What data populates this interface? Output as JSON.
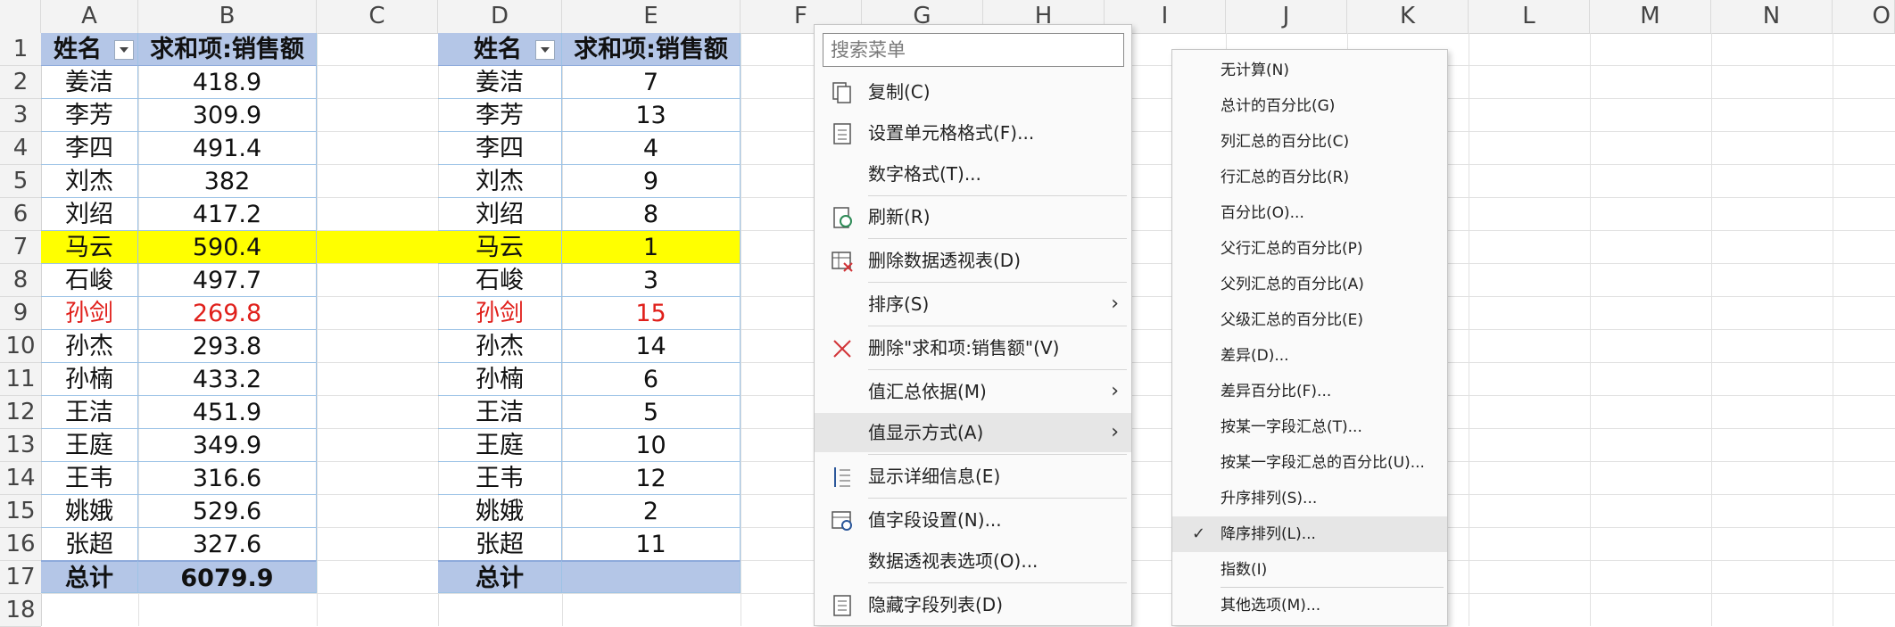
{
  "columns": [
    "A",
    "B",
    "C",
    "D",
    "E",
    "F",
    "G",
    "H",
    "I",
    "J",
    "K",
    "L",
    "M",
    "N",
    "O"
  ],
  "rows": [
    "1",
    "2",
    "3",
    "4",
    "5",
    "6",
    "7",
    "8",
    "9",
    "10",
    "11",
    "12",
    "13",
    "14",
    "15",
    "16",
    "17",
    "18"
  ],
  "pivot1": {
    "header_name": "姓名",
    "header_value": "求和项:销售额",
    "rows": [
      {
        "name": "姜洁",
        "value": "418.9"
      },
      {
        "name": "李芳",
        "value": "309.9"
      },
      {
        "name": "李四",
        "value": "491.4"
      },
      {
        "name": "刘杰",
        "value": "382"
      },
      {
        "name": "刘绍",
        "value": "417.2"
      },
      {
        "name": "马云",
        "value": "590.4"
      },
      {
        "name": "石峻",
        "value": "497.7"
      },
      {
        "name": "孙剑",
        "value": "269.8"
      },
      {
        "name": "孙杰",
        "value": "293.8"
      },
      {
        "name": "孙楠",
        "value": "433.2"
      },
      {
        "name": "王洁",
        "value": "451.9"
      },
      {
        "name": "王庭",
        "value": "349.9"
      },
      {
        "name": "王韦",
        "value": "316.6"
      },
      {
        "name": "姚娥",
        "value": "529.6"
      },
      {
        "name": "张超",
        "value": "327.6"
      }
    ],
    "total_label": "总计",
    "total_value": "6079.9"
  },
  "pivot2": {
    "header_name": "姓名",
    "header_value": "求和项:销售额",
    "rows": [
      {
        "name": "姜洁",
        "value": "7"
      },
      {
        "name": "李芳",
        "value": "13"
      },
      {
        "name": "李四",
        "value": "4"
      },
      {
        "name": "刘杰",
        "value": "9"
      },
      {
        "name": "刘绍",
        "value": "8"
      },
      {
        "name": "马云",
        "value": "1"
      },
      {
        "name": "石峻",
        "value": "3"
      },
      {
        "name": "孙剑",
        "value": "15"
      },
      {
        "name": "孙杰",
        "value": "14"
      },
      {
        "name": "孙楠",
        "value": "6"
      },
      {
        "name": "王洁",
        "value": "5"
      },
      {
        "name": "王庭",
        "value": "10"
      },
      {
        "name": "王韦",
        "value": "12"
      },
      {
        "name": "姚娥",
        "value": "2"
      },
      {
        "name": "张超",
        "value": "11"
      }
    ],
    "total_label": "总计",
    "total_value": ""
  },
  "highlight_color": "#ffff00",
  "red_color": "#e0201b",
  "header_color": "#b4c6e7",
  "context_menu": {
    "search_placeholder": "搜索菜单",
    "items": [
      {
        "label": "复制(C)",
        "icon": "copy-icon"
      },
      {
        "label": "设置单元格格式(F)...",
        "icon": "format-cells-icon"
      },
      {
        "label": "数字格式(T)...",
        "icon": ""
      },
      {
        "label": "刷新(R)",
        "icon": "refresh-icon"
      },
      {
        "label": "删除数据透视表(D)",
        "icon": "delete-pivot-icon"
      },
      {
        "label": "排序(S)",
        "icon": "",
        "submenu": true
      },
      {
        "label": "删除\"求和项:销售额\"(V)",
        "icon": "delete-x-icon"
      },
      {
        "label": "值汇总依据(M)",
        "icon": "",
        "submenu": true
      },
      {
        "label": "值显示方式(A)",
        "icon": "",
        "submenu": true
      },
      {
        "label": "显示详细信息(E)",
        "icon": "show-details-icon"
      },
      {
        "label": "值字段设置(N)...",
        "icon": "field-settings-icon"
      },
      {
        "label": "数据透视表选项(O)...",
        "icon": ""
      },
      {
        "label": "隐藏字段列表(D)",
        "icon": "field-list-icon"
      }
    ]
  },
  "submenu": {
    "items": [
      {
        "label": "无计算(N)"
      },
      {
        "label": "总计的百分比(G)"
      },
      {
        "label": "列汇总的百分比(C)"
      },
      {
        "label": "行汇总的百分比(R)"
      },
      {
        "label": "百分比(O)..."
      },
      {
        "label": "父行汇总的百分比(P)"
      },
      {
        "label": "父列汇总的百分比(A)"
      },
      {
        "label": "父级汇总的百分比(E)"
      },
      {
        "label": "差异(D)..."
      },
      {
        "label": "差异百分比(F)..."
      },
      {
        "label": "按某一字段汇总(T)..."
      },
      {
        "label": "按某一字段汇总的百分比(U)..."
      },
      {
        "label": "升序排列(S)..."
      },
      {
        "label": "降序排列(L)...",
        "checked": true
      },
      {
        "label": "指数(I)"
      },
      {
        "label": "其他选项(M)..."
      }
    ]
  }
}
